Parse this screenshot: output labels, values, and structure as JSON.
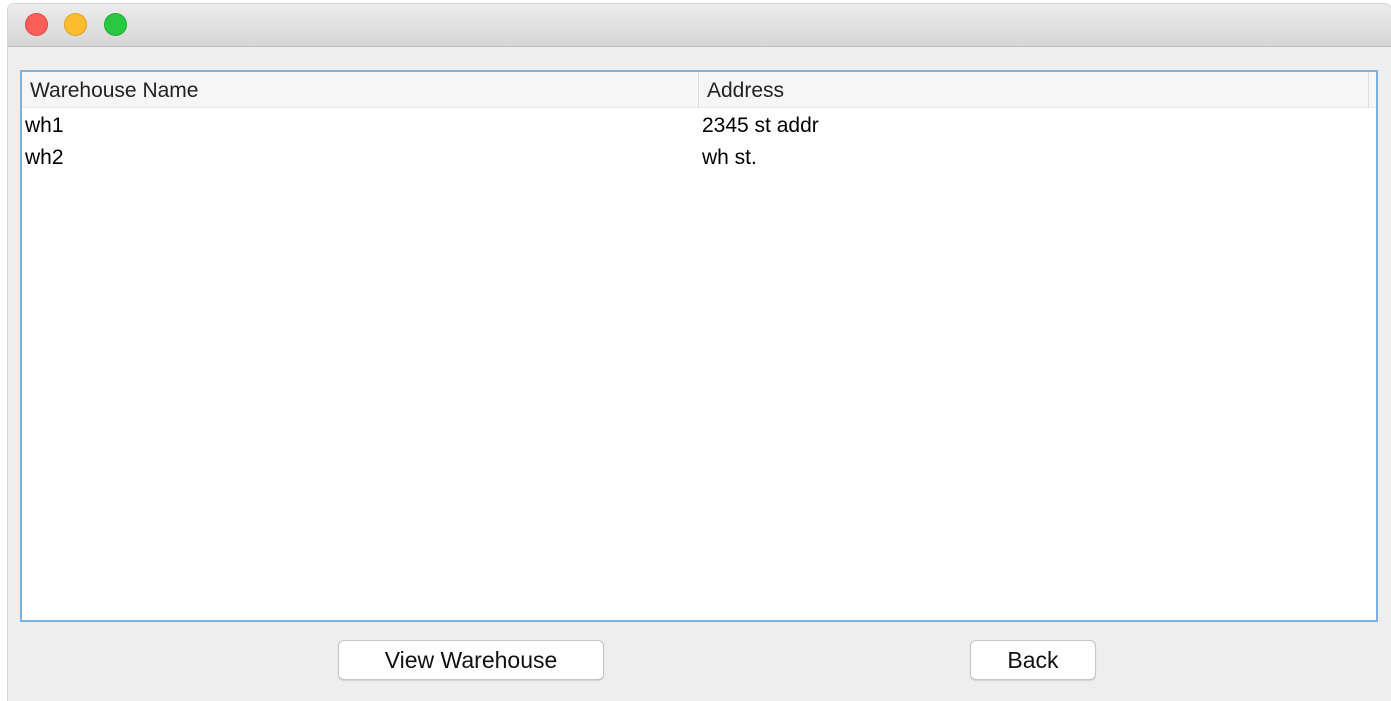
{
  "window": {
    "controls": [
      "close-icon",
      "minimize-icon",
      "maximize-icon"
    ],
    "colors": {
      "close": "#fc5f57",
      "minimize": "#fdbc2e",
      "maximize": "#28c840",
      "table_border": "#7fb0dd"
    }
  },
  "table": {
    "columns": [
      "Warehouse Name",
      "Address"
    ],
    "rows": [
      [
        "wh1",
        "2345 st addr"
      ],
      [
        "wh2",
        "wh st."
      ]
    ]
  },
  "buttons": {
    "view_warehouse": "View Warehouse",
    "back": "Back"
  }
}
